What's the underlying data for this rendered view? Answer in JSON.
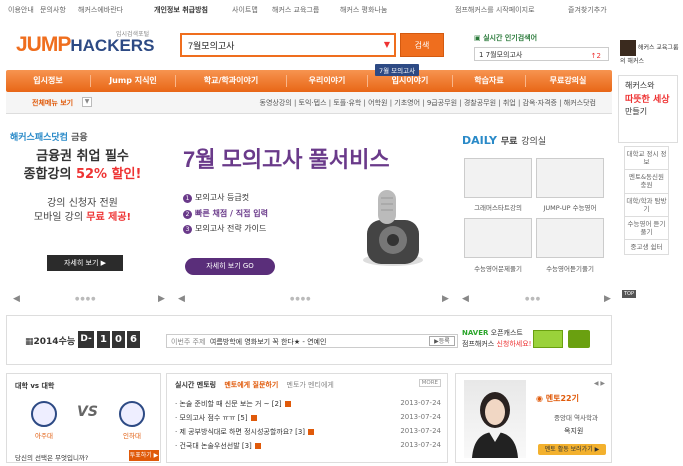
{
  "topbar": {
    "left_links": [
      "이용안내",
      "문의사항",
      "해커스에바란다",
      "개인정보 취급방침",
      "사이트맵",
      "해커스 교육그룹",
      "해커스 평화나눔"
    ],
    "right_links": [
      "점프해커스를 시작페이지로",
      "즐겨찾기추가"
    ]
  },
  "logo": {
    "brand_a": "JUMP",
    "brand_b": "HACKERS",
    "tagline": "입시검색포털"
  },
  "search": {
    "value": "7월모의고사",
    "button": "검색"
  },
  "popular": {
    "title": "실시간 인기검색어",
    "term": "1 7월모의고사",
    "rank_change": "↑2"
  },
  "side_banner_top": {
    "text": "해커스 교육그룹의 해커스"
  },
  "nav": {
    "items": [
      "입시정보",
      "Jump 지식인",
      "학교/학과이야기",
      "우리이야기",
      "입시이야기",
      "학습자료",
      "무료강의실"
    ],
    "tooltip": "7월 모의고사"
  },
  "subnav": {
    "all_menu": "전체메뉴 보기",
    "links": "동영상강의 | 토익·텝스 | 토플·유학 | 어학원 | 기초영어 | 9급공무원 | 경찰공무원 | 취업 | 감옥·자격증 | 해커스닷컴"
  },
  "promo_finance": {
    "title_a": "해커스패스닷컴",
    "title_b": "금융",
    "line1": "금융권 취업 필수",
    "line2_a": "종합강의",
    "line2_b": "52% 할인!",
    "line3": "강의 신청자 전원",
    "line4_a": "모바일 강의",
    "line4_b": "무료 제공!",
    "button": "자세히 보기 ▶"
  },
  "promo_mock": {
    "title": "7월 모의고사 풀서비스",
    "items": [
      {
        "num": "1",
        "text": "모의고사 등급컷"
      },
      {
        "num": "2",
        "text": "빠른 채점 / 직접 입력"
      },
      {
        "num": "3",
        "text": "모의고사 전략 가이드"
      }
    ],
    "button": "자세히 보기 GO"
  },
  "daily": {
    "title_a": "DAILY",
    "title_b": "무료",
    "title_c": "강의실",
    "courses": [
      "그래머스타트강의",
      "JUMP-UP 수능영어",
      "수능영어문제풀기",
      "수능영어듣기풀기"
    ]
  },
  "countdown": {
    "label": "2014수능",
    "prefix": "D-",
    "digits": [
      "1",
      "0",
      "6"
    ]
  },
  "ticker": {
    "label": "이번주 주제",
    "text": "여름방학에 영화보기 꼭 한다★ - 연예인",
    "register": "▶등록"
  },
  "naver": {
    "brand": "NAVER",
    "title": "오픈캐스트",
    "line2_a": "점프해커스",
    "line2_b": "신청하세요!"
  },
  "university": {
    "title": "대학 vs 대학",
    "vs": "VS",
    "left": "아주대",
    "right": "인하대",
    "question": "당신의 선택은 무엇입니까?",
    "button": "투표하기 ▶"
  },
  "mentoring": {
    "title": "실시간 멘토링",
    "tab_active": "멘토에게 질문하기",
    "tab_other": "멘토가 멘티에게",
    "more": "MORE",
    "rows": [
      {
        "title": "논술 준비할 때 신문 보는 거 ~ [2]",
        "date": "2013-07-24"
      },
      {
        "title": "모의고사 점수 ㅠㅠ [5]",
        "date": "2013-07-24"
      },
      {
        "title": "제 공부방식대로 하면 정시성공할까요? [3]",
        "date": "2013-07-24"
      },
      {
        "title": "건국대 논술우선선발 [3]",
        "date": "2013-07-24"
      }
    ]
  },
  "mentor_profile": {
    "heading": "멘토22기",
    "role": "중앙대 역사학과",
    "name": "옥지원",
    "button": "멘토 활동 보러가기 ▶",
    "pager": "◀ ▶"
  },
  "side": {
    "line1": "해커스와",
    "line2": "따뜻한 세상",
    "line3": "만들기",
    "menu": [
      "대학교 정시 정보",
      "멘토&동신원 충원",
      "대학/학과 탐방기",
      "수능영어 듣기풀기",
      "중고생 쉼터"
    ],
    "top": "TOP"
  },
  "colors": {
    "accent": "#ef6e1e",
    "brand": "#2d4a84",
    "purple": "#6a3a8a"
  }
}
